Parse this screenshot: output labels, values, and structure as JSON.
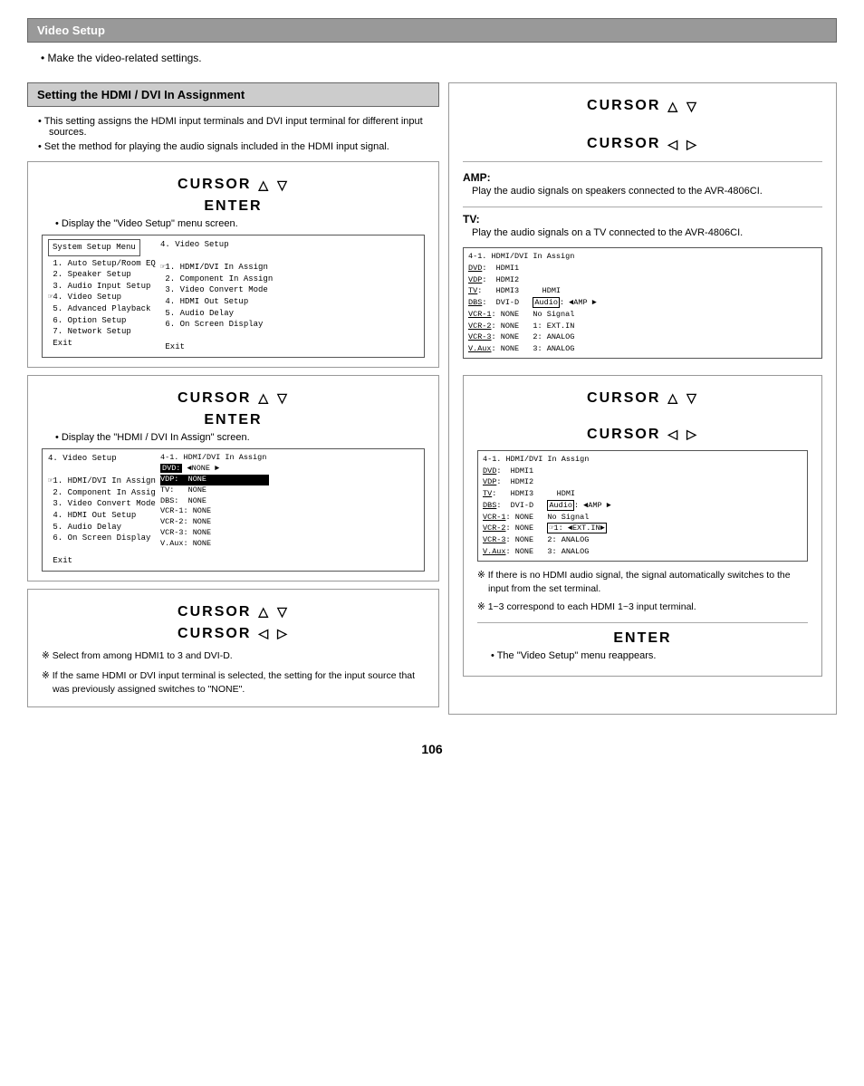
{
  "header": {
    "title": "Video Setup"
  },
  "intro": {
    "bullet": "Make the video-related settings."
  },
  "left_section": {
    "title": "Setting the HDMI / DVI In Assignment",
    "bullets": [
      "This setting assigns the HDMI input terminals and DVI input terminal for different input sources.",
      "Set the method for playing the audio signals included in the HDMI input signal."
    ],
    "box1": {
      "cursor_ud": "CURSOR △  ▽",
      "enter": "ENTER",
      "desc": "Display the \"Video Setup\" menu screen."
    },
    "box2": {
      "cursor_ud": "CURSOR △  ▽",
      "enter": "ENTER",
      "desc": "Display the \"HDMI / DVI In Assign\" screen."
    },
    "box3": {
      "cursor_ud": "CURSOR △  ▽",
      "cursor_lr": "CURSOR ◁  ▷"
    },
    "notes": [
      "Select from among HDMI1 to 3 and DVI-D.",
      "If the same HDMI or DVI input terminal is selected, the setting for the input source that was previously assigned switches to \"NONE\"."
    ]
  },
  "right_section": {
    "cursor_ud_top": "CURSOR △  ▽",
    "cursor_lr_top": "CURSOR ◁  ▷",
    "amp_label": "AMP:",
    "amp_desc": "Play the audio signals on speakers connected to the AVR-4806CI.",
    "tv_label": "TV:",
    "tv_desc": "Play the audio signals on a TV connected to the AVR-4806CI.",
    "bottom": {
      "cursor_ud": "CURSOR △  ▽",
      "cursor_lr": "CURSOR ◁  ▷",
      "notes": [
        "If there is no HDMI audio signal, the signal automatically switches to the input from the set terminal.",
        "1~3 correspond to each HDMI 1~3 input terminal."
      ],
      "enter": "ENTER",
      "enter_desc": "The \"Video Setup\" menu reappears."
    }
  },
  "page_number": "106"
}
